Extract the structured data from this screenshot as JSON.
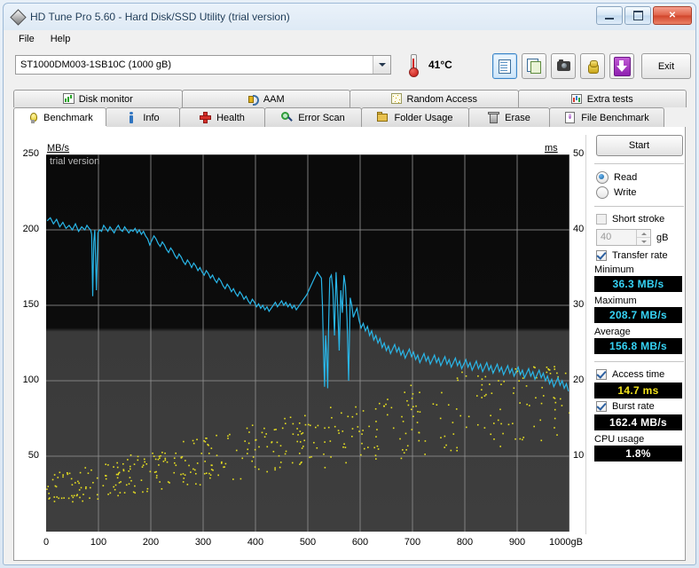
{
  "window": {
    "title": "HD Tune Pro 5.60 - Hard Disk/SSD Utility (trial version)",
    "icon": "hdtune-diamond-icon",
    "minimize": "minimize-icon",
    "maximize": "maximize-icon",
    "close": "✕"
  },
  "menu": {
    "items": [
      "File",
      "Help"
    ]
  },
  "toolbar": {
    "drive": "ST1000DM003-1SB10C (1000 gB)",
    "temperature": "41°C",
    "buttons": [
      {
        "name": "copy-text-button",
        "icon": "copy-document-icon",
        "selected": true
      },
      {
        "name": "copy-image-button",
        "icon": "copy-image-icon",
        "selected": false
      },
      {
        "name": "screenshot-button",
        "icon": "camera-icon",
        "selected": false
      },
      {
        "name": "hand-button",
        "icon": "hand-icon",
        "selected": false
      },
      {
        "name": "save-button",
        "icon": "purple-down-arrow-icon",
        "selected": false
      }
    ],
    "exit_label": "Exit"
  },
  "tabs_top": [
    {
      "label": "Disk monitor",
      "icon": "bar-chart-icon"
    },
    {
      "label": "AAM",
      "icon": "speaker-icon"
    },
    {
      "label": "Random Access",
      "icon": "scatter-icon"
    },
    {
      "label": "Extra tests",
      "icon": "chart-icon"
    }
  ],
  "tabs_bottom": [
    {
      "label": "Benchmark",
      "icon": "lightbulb-icon",
      "active": true,
      "width": 105
    },
    {
      "label": "Info",
      "icon": "info-icon",
      "active": false,
      "width": 84
    },
    {
      "label": "Health",
      "icon": "red-cross-icon",
      "active": false,
      "width": 97
    },
    {
      "label": "Error Scan",
      "icon": "magnifier-icon",
      "active": false,
      "width": 110
    },
    {
      "label": "Folder Usage",
      "icon": "folder-icon",
      "active": false,
      "width": 122
    },
    {
      "label": "Erase",
      "icon": "trash-bin-icon",
      "active": false,
      "width": 92
    },
    {
      "label": "File Benchmark",
      "icon": "file-benchmark-icon",
      "active": false,
      "width": 130
    }
  ],
  "panel": {
    "start_label": "Start",
    "mode": {
      "read_label": "Read",
      "write_label": "Write",
      "selected": "Read"
    },
    "short_stroke": {
      "label": "Short stroke",
      "checked": false,
      "value": "40",
      "unit": "gB"
    },
    "transfer_rate": {
      "label": "Transfer rate",
      "checked": true
    },
    "minimum": {
      "label": "Minimum",
      "value": "36.3 MB/s",
      "color": "#36d3f5"
    },
    "maximum": {
      "label": "Maximum",
      "value": "208.7 MB/s",
      "color": "#36d3f5"
    },
    "average": {
      "label": "Average",
      "value": "156.8 MB/s",
      "color": "#36d3f5"
    },
    "access_time": {
      "label": "Access time",
      "checked": true,
      "value": "14.7 ms",
      "color": "#f2e31c"
    },
    "burst_rate": {
      "label": "Burst rate",
      "checked": true,
      "value": "162.4 MB/s",
      "color": "#ffffff"
    },
    "cpu_usage": {
      "label": "CPU usage",
      "value": "1.8%",
      "color": "#ffffff"
    }
  },
  "chart_data": {
    "type": "line",
    "title": "",
    "watermark": "trial version",
    "xlabel": "gB",
    "ylabel": "MB/s",
    "y2label": "ms",
    "xlim": [
      0,
      1000
    ],
    "ylim": [
      0,
      250
    ],
    "y2lim": [
      0,
      50
    ],
    "grid": true,
    "xticks": [
      0,
      100,
      200,
      300,
      400,
      500,
      600,
      700,
      800,
      900,
      1000
    ],
    "xtick_labels": [
      "0",
      "100",
      "200",
      "300",
      "400",
      "500",
      "600",
      "700",
      "800",
      "900",
      "1000gB"
    ],
    "yticks": [
      50,
      100,
      150,
      200,
      250
    ],
    "ytick_labels": [
      "50",
      "100",
      "150",
      "200",
      "250"
    ],
    "y2ticks": [
      10,
      20,
      30,
      40,
      50
    ],
    "y2tick_labels": [
      "10",
      "20",
      "30",
      "40",
      "50"
    ],
    "series": [
      {
        "name": "Transfer rate",
        "type": "line",
        "color": "#29b6e8",
        "axis": "left",
        "x": [
          2,
          8,
          14,
          20,
          26,
          32,
          38,
          44,
          50,
          56,
          62,
          68,
          74,
          78,
          82,
          85,
          87,
          89,
          91,
          93,
          96,
          99,
          102,
          106,
          110,
          114,
          118,
          122,
          126,
          130,
          134,
          138,
          142,
          146,
          150,
          154,
          158,
          162,
          166,
          170,
          174,
          178,
          182,
          186,
          190,
          194,
          198,
          202,
          206,
          210,
          214,
          218,
          222,
          226,
          230,
          234,
          238,
          242,
          246,
          250,
          254,
          258,
          262,
          266,
          270,
          274,
          278,
          282,
          286,
          290,
          294,
          298,
          302,
          306,
          310,
          314,
          318,
          322,
          326,
          330,
          334,
          338,
          342,
          346,
          350,
          354,
          358,
          362,
          366,
          370,
          374,
          378,
          382,
          386,
          390,
          394,
          398,
          402,
          406,
          410,
          414,
          418,
          422,
          426,
          430,
          434,
          438,
          442,
          446,
          450,
          454,
          458,
          462,
          466,
          470,
          474,
          478,
          482,
          486,
          490,
          494,
          498,
          502,
          506,
          510,
          514,
          518,
          522,
          526,
          528,
          530,
          532,
          534,
          536,
          538,
          540,
          542,
          545,
          548,
          551,
          554,
          557,
          560,
          563,
          566,
          569,
          572,
          575,
          578,
          581,
          584,
          587,
          590,
          594,
          598,
          602,
          606,
          610,
          614,
          618,
          622,
          626,
          630,
          634,
          638,
          642,
          646,
          650,
          654,
          658,
          662,
          666,
          670,
          674,
          678,
          682,
          686,
          690,
          694,
          698,
          702,
          706,
          710,
          714,
          718,
          722,
          726,
          730,
          734,
          738,
          742,
          746,
          750,
          754,
          758,
          762,
          766,
          770,
          774,
          778,
          782,
          786,
          790,
          794,
          798,
          802,
          806,
          810,
          814,
          818,
          822,
          826,
          830,
          834,
          838,
          842,
          846,
          850,
          854,
          858,
          862,
          866,
          870,
          874,
          878,
          882,
          886,
          890,
          894,
          898,
          902,
          906,
          910,
          914,
          918,
          922,
          926,
          930,
          934,
          938,
          942,
          946,
          950,
          954,
          958,
          962,
          966,
          970,
          974,
          978,
          982,
          986,
          990,
          994,
          998
        ],
        "y": [
          206,
          208,
          204,
          207,
          202,
          205,
          201,
          203,
          200,
          204,
          199,
          202,
          200,
          203,
          201,
          200,
          197,
          156,
          192,
          200,
          160,
          198,
          200,
          199,
          203,
          201,
          199,
          202,
          200,
          198,
          201,
          203,
          200,
          199,
          202,
          200,
          198,
          200,
          199,
          201,
          198,
          200,
          197,
          199,
          196,
          194,
          190,
          193,
          196,
          194,
          191,
          189,
          192,
          190,
          187,
          185,
          188,
          186,
          183,
          181,
          184,
          182,
          179,
          177,
          180,
          178,
          175,
          178,
          176,
          173,
          175,
          172,
          170,
          173,
          171,
          168,
          170,
          167,
          165,
          168,
          166,
          163,
          161,
          164,
          162,
          159,
          161,
          158,
          156,
          159,
          157,
          154,
          156,
          153,
          151,
          154,
          152,
          149,
          151,
          148,
          150,
          147,
          149,
          146,
          148,
          150,
          152,
          149,
          151,
          153,
          150,
          152,
          149,
          151,
          148,
          150,
          147,
          149,
          151,
          153,
          155,
          157,
          160,
          163,
          166,
          169,
          172,
          170,
          168,
          150,
          120,
          96,
          130,
          118,
          95,
          140,
          168,
          170,
          160,
          130,
          172,
          150,
          120,
          160,
          145,
          170,
          163,
          140,
          100,
          155,
          150,
          142,
          145,
          148,
          140,
          135,
          138,
          133,
          136,
          130,
          133,
          127,
          130,
          125,
          128,
          122,
          125,
          120,
          123,
          118,
          121,
          124,
          119,
          122,
          117,
          120,
          115,
          118,
          121,
          116,
          119,
          114,
          117,
          112,
          115,
          118,
          113,
          116,
          111,
          114,
          117,
          112,
          115,
          110,
          113,
          116,
          111,
          114,
          109,
          112,
          115,
          110,
          113,
          108,
          111,
          114,
          109,
          112,
          107,
          110,
          113,
          108,
          111,
          106,
          109,
          112,
          107,
          110,
          105,
          108,
          111,
          106,
          109,
          104,
          107,
          110,
          105,
          108,
          103,
          106,
          109,
          104,
          107,
          102,
          105,
          108,
          103,
          106,
          101,
          104,
          107,
          102,
          105,
          100,
          103,
          98,
          101,
          96,
          99,
          102,
          97,
          100,
          95,
          98,
          93,
          96,
          99,
          94,
          97,
          92,
          95,
          90,
          86,
          75
        ]
      },
      {
        "name": "Access time",
        "type": "scatter",
        "color": "#e8e020",
        "axis": "right",
        "description": "Scattered yellow dots rising from about 6 ms at 0 gB to about 20 ms at 1000 gB, forming a widening band across the plot.",
        "range_ms": [
          4,
          22
        ]
      }
    ]
  }
}
